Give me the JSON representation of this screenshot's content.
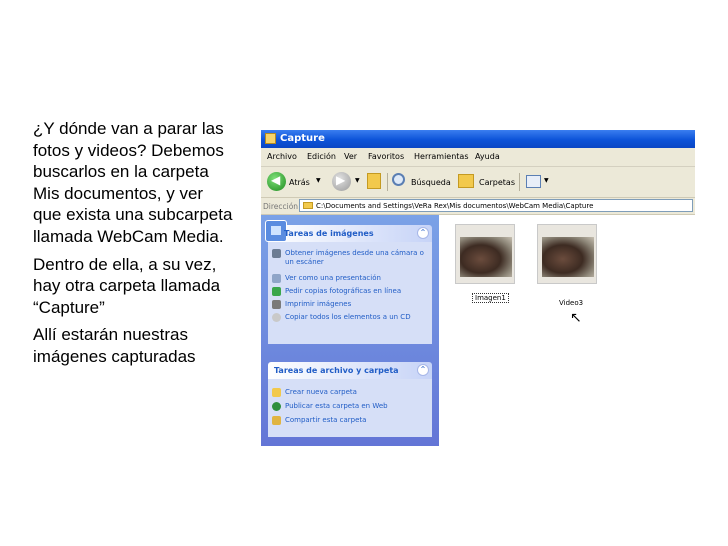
{
  "slide": {
    "paragraphs": [
      "¿Y dónde van a parar las fotos y videos? Debemos buscarlos en la carpeta Mis documentos, y ver que exista una subcarpeta llamada WebCam Media.",
      "Dentro de ella, a su vez, hay otra carpeta llamada “Capture”",
      "Allí estarán nuestras imágenes capturadas"
    ]
  },
  "window": {
    "title": "Capture",
    "menu": [
      "Archivo",
      "Edición",
      "Ver",
      "Favoritos",
      "Herramientas",
      "Ayuda"
    ],
    "toolbar": {
      "back_label": "Atrás",
      "search_label": "Búsqueda",
      "folders_label": "Carpetas"
    },
    "address": {
      "label": "Dirección",
      "path": "C:\\Documents and Settings\\VeRa Rex\\Mis documentos\\WebCam Media\\Capture"
    }
  },
  "taskpane": {
    "image_tasks": {
      "title": "Tareas de imágenes",
      "items": [
        "Obtener imágenes desde una cámara o un escáner",
        "Ver como una presentación",
        "Pedir copias fotográficas en línea",
        "Imprimir imágenes",
        "Copiar todos los elementos a un CD"
      ]
    },
    "file_tasks": {
      "title": "Tareas de archivo y carpeta",
      "items": [
        "Crear nueva carpeta",
        "Publicar esta carpeta en Web",
        "Compartir esta carpeta"
      ]
    }
  },
  "files": [
    {
      "name": "Imagen1",
      "selected": true
    },
    {
      "name": "Video3",
      "selected": false
    }
  ],
  "colors": {
    "titlebar": "#0c53d8",
    "pane_link": "#215dc6",
    "chrome": "#ece9d8"
  }
}
